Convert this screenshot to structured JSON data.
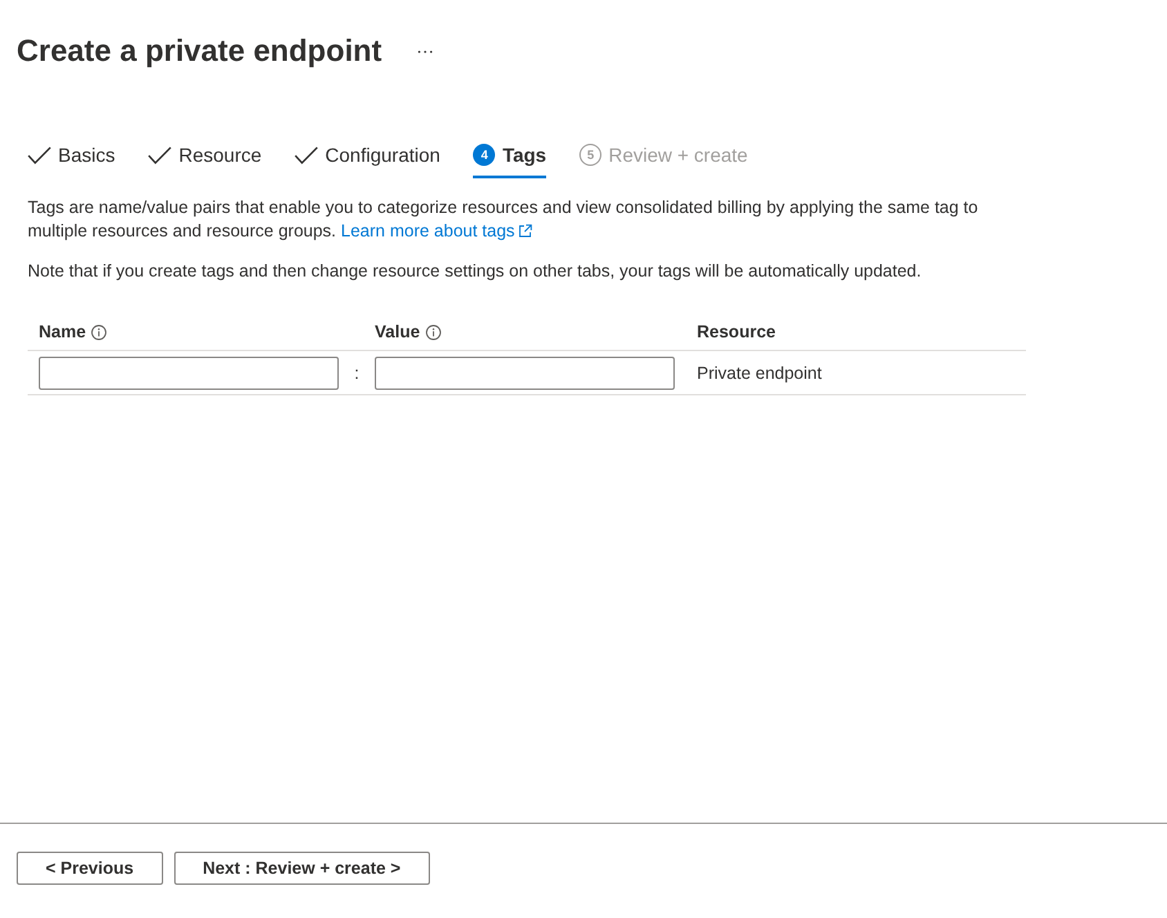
{
  "header": {
    "title": "Create a private endpoint"
  },
  "tabs": [
    {
      "label": "Basics",
      "kind": "done",
      "selected": false
    },
    {
      "label": "Resource",
      "kind": "done",
      "selected": false
    },
    {
      "label": "Configuration",
      "kind": "done",
      "selected": false
    },
    {
      "label": "Tags",
      "step": "4",
      "kind": "current",
      "selected": true
    },
    {
      "label": "Review + create",
      "step": "5",
      "kind": "upcoming",
      "selected": false
    }
  ],
  "intro": {
    "text": "Tags are name/value pairs that enable you to categorize resources and view consolidated billing by applying the same tag to multiple resources and resource groups.",
    "link": "Learn more about tags"
  },
  "note": "Note that if you create tags and then change resource settings on other tabs, your tags will be automatically updated.",
  "table": {
    "columns": [
      {
        "label": "Name",
        "kind": "info"
      },
      {
        "label": "Value",
        "kind": "info"
      },
      {
        "label": "Resource",
        "kind": "plain"
      }
    ],
    "rows": [
      {
        "separator": ":",
        "resource": "Private endpoint"
      }
    ]
  },
  "footer": {
    "buttons": [
      "< Previous",
      "Next : Review + create >"
    ]
  }
}
